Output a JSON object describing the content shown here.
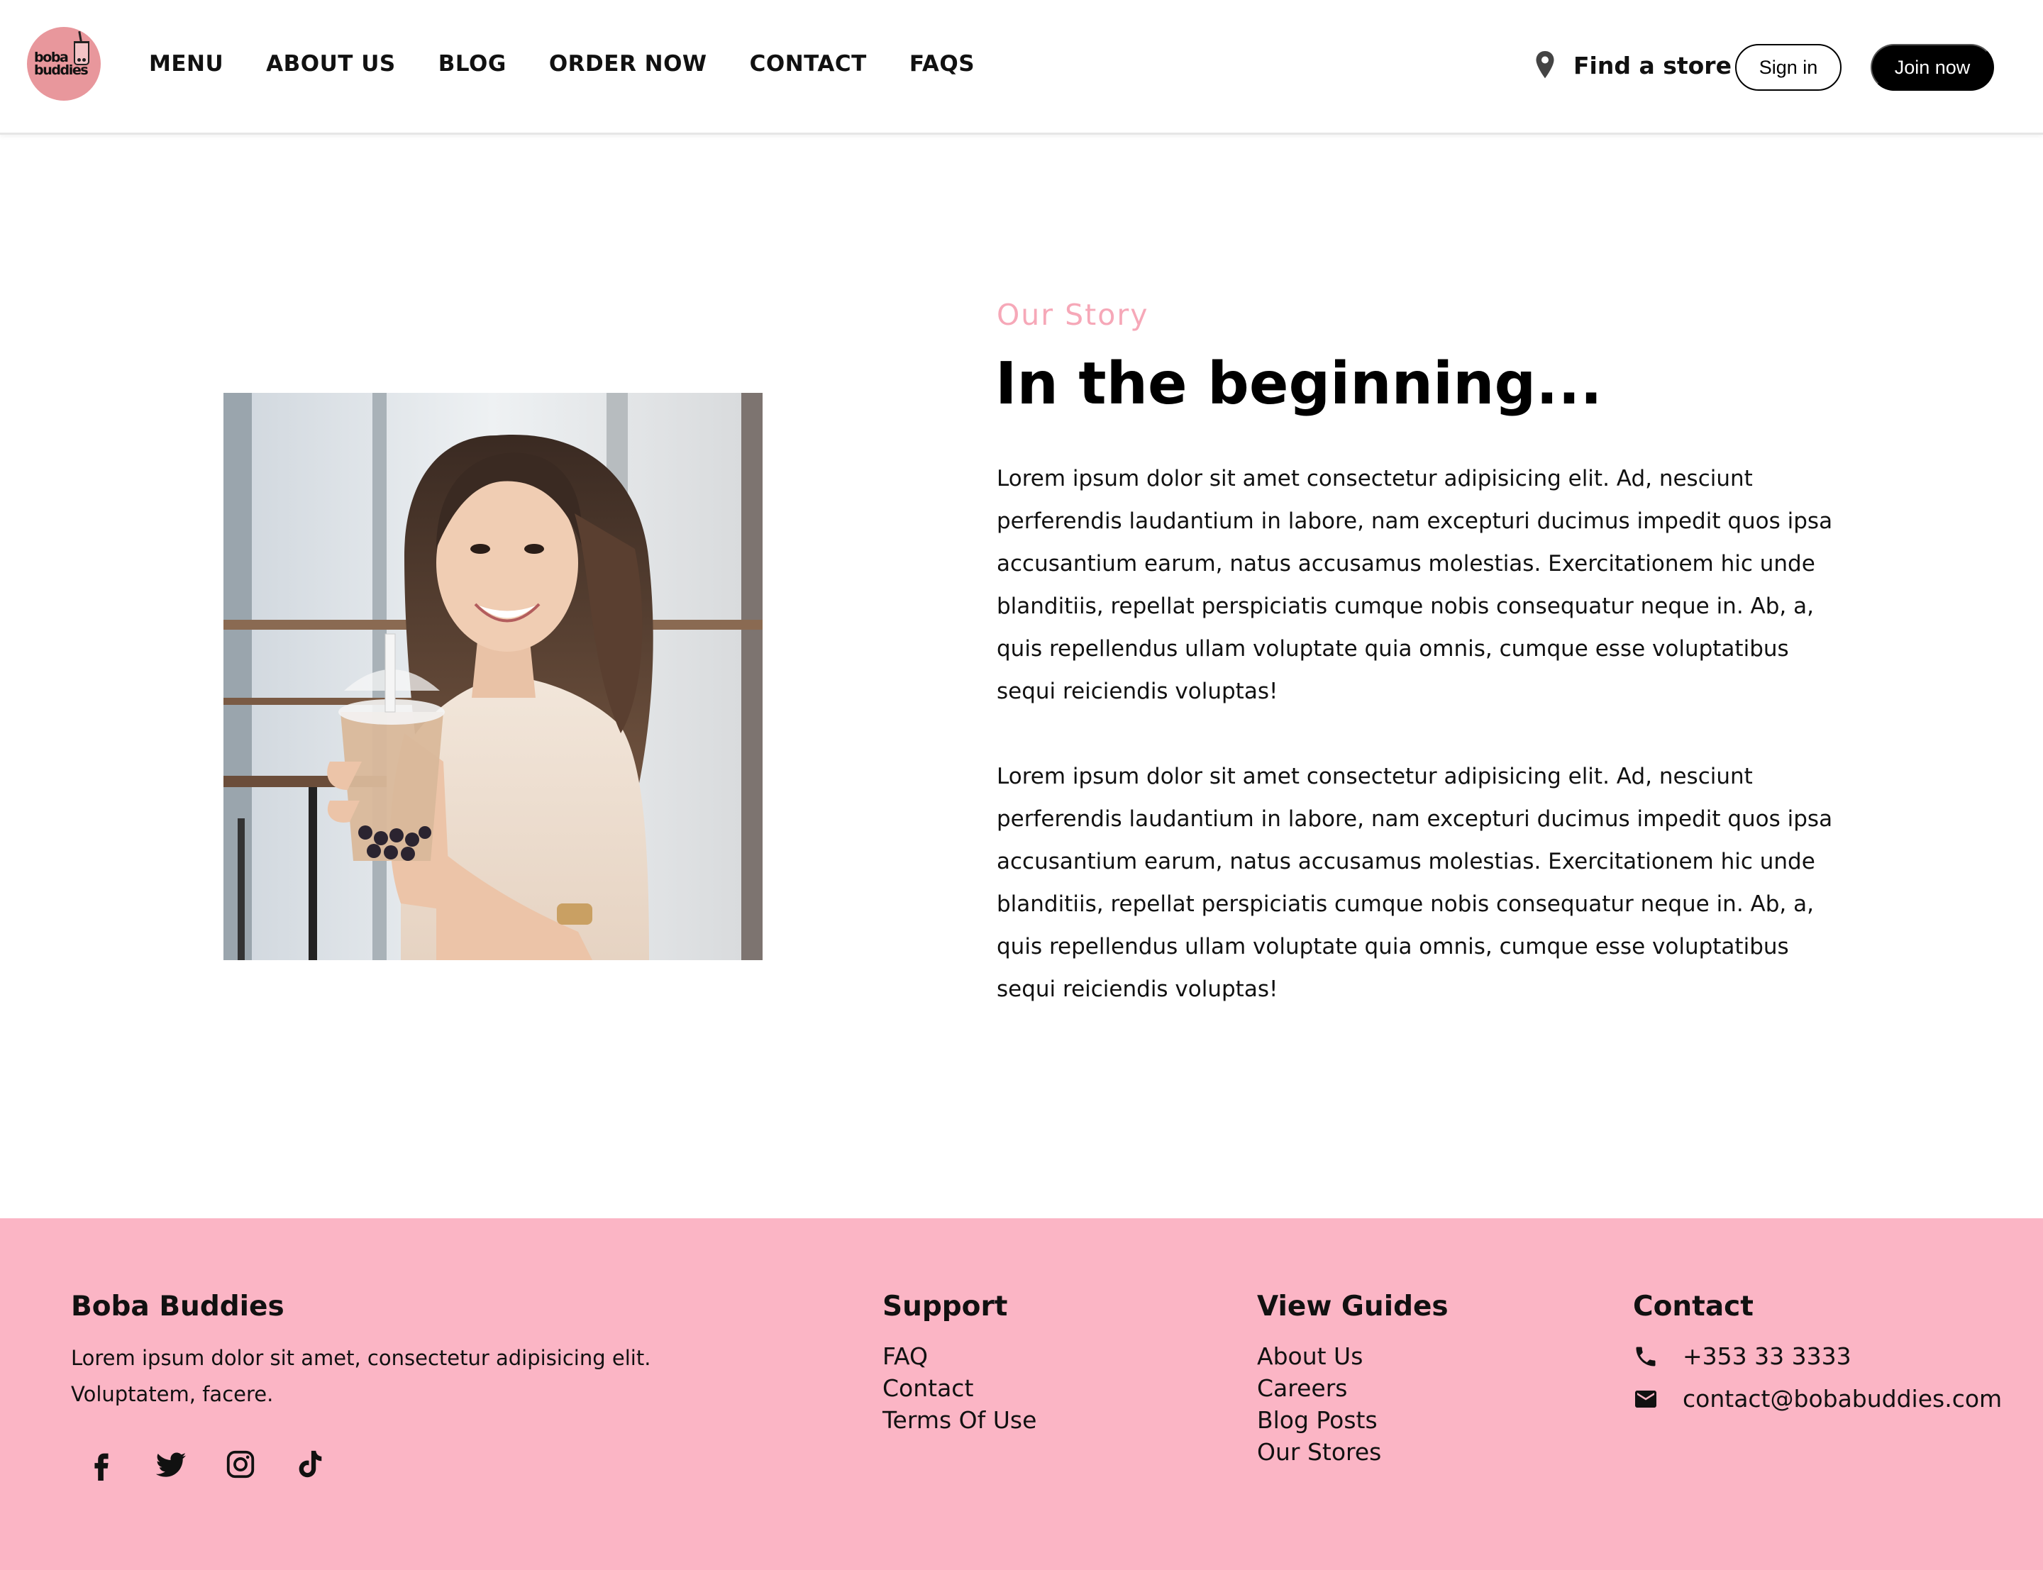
{
  "header": {
    "logo": {
      "line1": "boba",
      "line2": "buddies"
    },
    "nav": [
      "MENU",
      "ABOUT US",
      "BLOG",
      "ORDER NOW",
      "CONTACT",
      "FAQS"
    ],
    "find_store": "Find a store",
    "sign_in": "Sign in",
    "join_now": "Join now"
  },
  "story": {
    "eyebrow": "Our Story",
    "title": "In the beginning...",
    "paragraphs": [
      "Lorem ipsum dolor sit amet consectetur adipisicing elit. Ad, nesciunt perferendis laudantium in labore, nam excepturi ducimus impedit quos ipsa accusantium earum, natus accusamus molestias. Exercitationem hic unde blanditiis, repellat perspiciatis cumque nobis consequatur neque in. Ab, a, quis repellendus ullam voluptate quia omnis, cumque esse voluptatibus sequi reiciendis voluptas!",
      "Lorem ipsum dolor sit amet consectetur adipisicing elit. Ad, nesciunt perferendis laudantium in labore, nam excepturi ducimus impedit quos ipsa accusantium earum, natus accusamus molestias. Exercitationem hic unde blanditiis, repellat perspiciatis cumque nobis consequatur neque in. Ab, a, quis repellendus ullam voluptate quia omnis, cumque esse voluptatibus sequi reiciendis voluptas!"
    ]
  },
  "footer": {
    "brand": {
      "title": "Boba Buddies",
      "text": "Lorem ipsum dolor sit amet, consectetur adipisicing elit. Voluptatem, facere."
    },
    "social_icons": [
      "facebook-icon",
      "twitter-icon",
      "instagram-icon",
      "tiktok-icon"
    ],
    "support": {
      "title": "Support",
      "links": [
        "FAQ",
        "Contact",
        "Terms Of Use"
      ]
    },
    "guides": {
      "title": "View Guides",
      "links": [
        "About Us",
        "Careers",
        "Blog Posts",
        "Our Stores"
      ]
    },
    "contact": {
      "title": "Contact",
      "phone": "+353 33 3333",
      "email": "contact@bobabuddies.com"
    }
  },
  "colors": {
    "accent_pink": "#f6a8b8",
    "footer_pink": "#fbb5c5",
    "logo_pink": "#e8979c",
    "primary_button": "#000000"
  }
}
